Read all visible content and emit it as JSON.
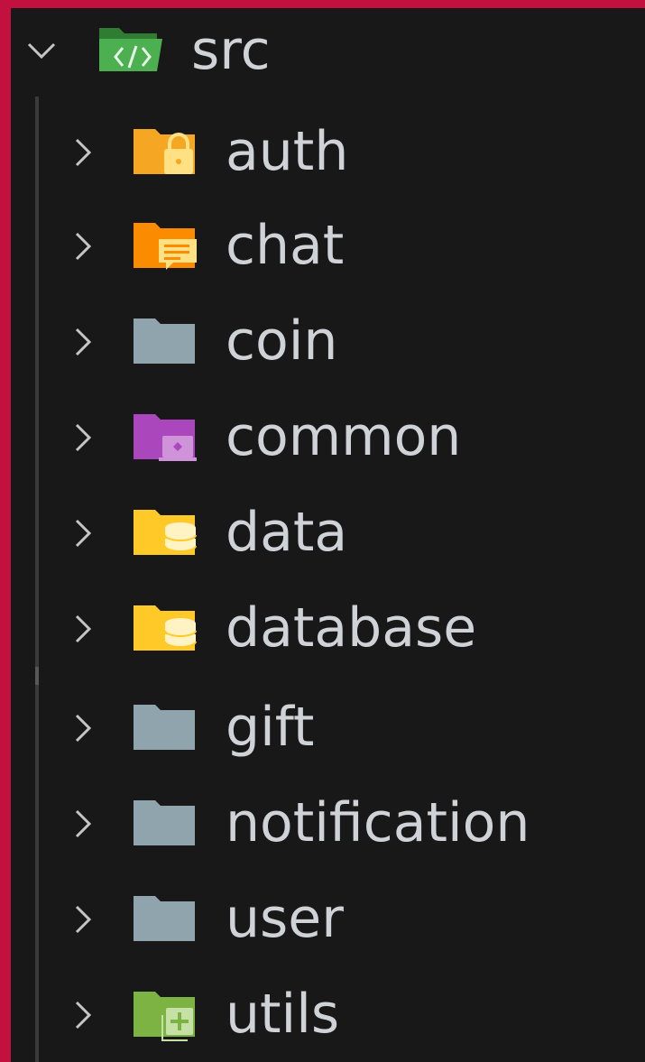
{
  "explorer": {
    "root": {
      "label": "src",
      "expanded": true,
      "icon": "folder-src-open-icon",
      "color": "#4caf50"
    },
    "items": [
      {
        "label": "auth",
        "icon": "folder-auth-icon",
        "color": "#f5a623"
      },
      {
        "label": "chat",
        "icon": "folder-chat-icon",
        "color": "#fb8c00"
      },
      {
        "label": "coin",
        "icon": "folder-icon",
        "color": "#90a4ae"
      },
      {
        "label": "common",
        "icon": "folder-common-icon",
        "color": "#ab47bc"
      },
      {
        "label": "data",
        "icon": "folder-data-icon",
        "color": "#ffca28"
      },
      {
        "label": "database",
        "icon": "folder-database-icon",
        "color": "#ffca28"
      },
      {
        "label": "gift",
        "icon": "folder-icon",
        "color": "#90a4ae"
      },
      {
        "label": "notification",
        "icon": "folder-icon",
        "color": "#90a4ae"
      },
      {
        "label": "user",
        "icon": "folder-icon",
        "color": "#90a4ae"
      },
      {
        "label": "utils",
        "icon": "folder-utils-icon",
        "color": "#7cb342"
      }
    ]
  },
  "colors": {
    "background": "#181818",
    "accent_border": "#c2103f",
    "text": "#cfd3d8",
    "chevron": "#c5c5c5"
  }
}
